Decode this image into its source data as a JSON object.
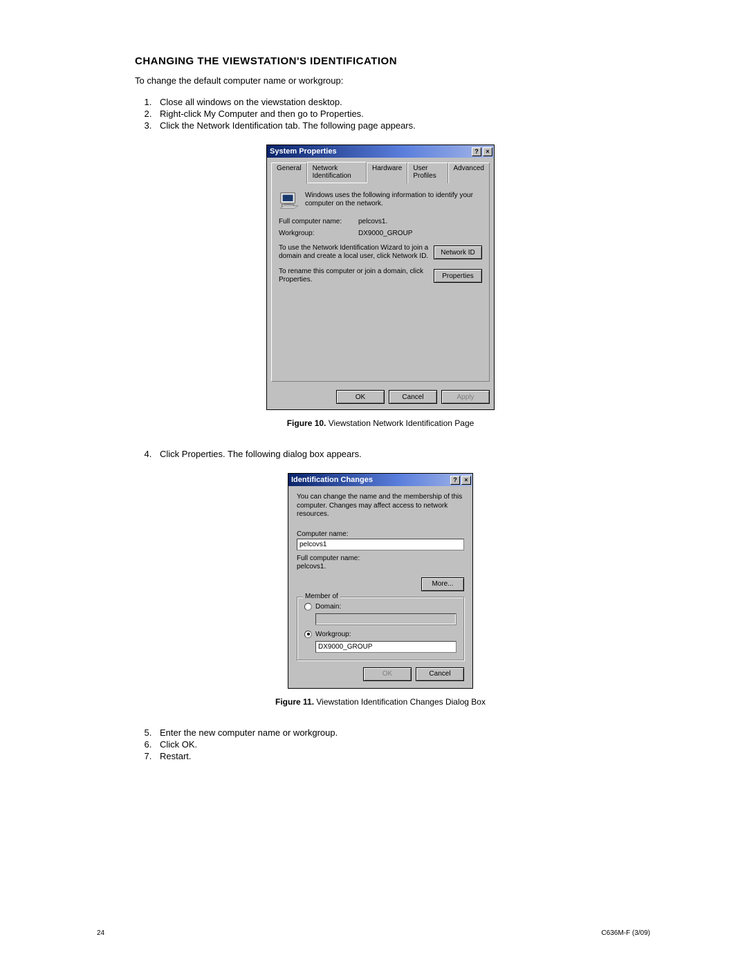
{
  "heading": "CHANGING THE VIEWSTATION'S IDENTIFICATION",
  "intro": "To change the default computer name or workgroup:",
  "steps_a": [
    "Close all windows on the viewstation desktop.",
    "Right-click My Computer and then go to Properties.",
    "Click the Network Identification tab. The following page appears."
  ],
  "steps_b_start": 4,
  "steps_b": [
    "Click Properties. The following dialog box appears."
  ],
  "steps_c_start": 5,
  "steps_c": [
    "Enter the new computer name or workgroup.",
    "Click OK.",
    "Restart."
  ],
  "fig10_label": "Figure 10.",
  "fig10_text": "Viewstation Network Identification Page",
  "fig11_label": "Figure 11.",
  "fig11_text": "Viewstation Identification Changes Dialog Box",
  "footer_left": "24",
  "footer_right": "C636M-F (3/09)",
  "dlg1": {
    "title": "System Properties",
    "help_glyph": "?",
    "close_glyph": "×",
    "tabs": [
      "General",
      "Network Identification",
      "Hardware",
      "User Profiles",
      "Advanced"
    ],
    "active_tab_index": 1,
    "info_text": "Windows uses the following information to identify your computer on the network.",
    "fcn_label": "Full computer name:",
    "fcn_value": "pelcovs1.",
    "wg_label": "Workgroup:",
    "wg_value": "DX9000_GROUP",
    "wizard_text": "To use the Network Identification Wizard to join a domain and create a local user, click Network ID.",
    "networkid_btn": "Network ID",
    "rename_text": "To rename this computer or join a domain, click Properties.",
    "properties_btn": "Properties",
    "ok_btn": "OK",
    "cancel_btn": "Cancel",
    "apply_btn": "Apply"
  },
  "dlg2": {
    "title": "Identification Changes",
    "help_glyph": "?",
    "close_glyph": "×",
    "desc": "You can change the name and the membership of this computer. Changes may affect access to network resources.",
    "cn_label": "Computer name:",
    "cn_value": "pelcovs1",
    "fcn_label": "Full computer name:",
    "fcn_value": "pelcovs1.",
    "more_btn": "More...",
    "group_legend": "Member of",
    "domain_label": "Domain:",
    "workgroup_label": "Workgroup:",
    "workgroup_value": "DX9000_GROUP",
    "ok_btn": "OK",
    "cancel_btn": "Cancel"
  }
}
